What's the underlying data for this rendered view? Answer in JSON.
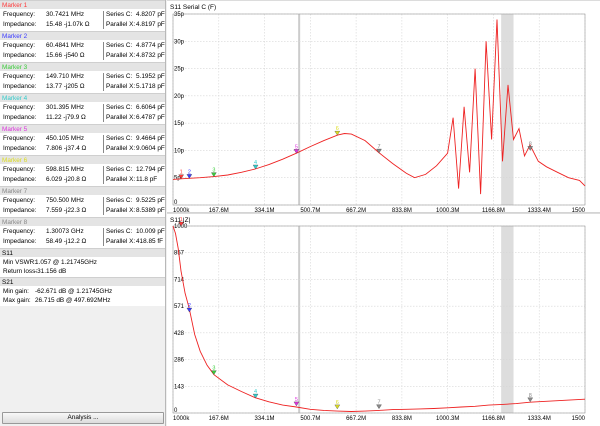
{
  "markers": [
    {
      "title": "Marker 1",
      "color": "#ff3a3a",
      "freq_label": "Frequency:",
      "freq": "30.7421 MHz",
      "imp_label": "Impedance:",
      "imp": "15.48 -j1.07k Ω",
      "r1_label": "Series C:",
      "r1": "4.8207 pF",
      "r2_label": "Parallel X:",
      "r2": "4.8197 pF"
    },
    {
      "title": "Marker 2",
      "color": "#3a3aff",
      "freq_label": "Frequency:",
      "freq": "60.4841 MHz",
      "imp_label": "Impedance:",
      "imp": "15.66 -j540 Ω",
      "r1_label": "Series C:",
      "r1": "4.8774 pF",
      "r2_label": "Parallel X:",
      "r2": "4.8732 pF"
    },
    {
      "title": "Marker 3",
      "color": "#3acc3a",
      "freq_label": "Frequency:",
      "freq": "149.710 MHz",
      "imp_label": "Impedance:",
      "imp": "13.77 -j205 Ω",
      "r1_label": "Series C:",
      "r1": "5.1952 pF",
      "r2_label": "Parallel X:",
      "r2": "5.1718 pF"
    },
    {
      "title": "Marker 4",
      "color": "#33cccc",
      "freq_label": "Frequency:",
      "freq": "301.395 MHz",
      "imp_label": "Impedance:",
      "imp": "11.22 -j79.9 Ω",
      "r1_label": "Series C:",
      "r1": "6.6064 pF",
      "r2_label": "Parallel X:",
      "r2": "6.4787 pF"
    },
    {
      "title": "Marker 5",
      "color": "#dd33dd",
      "freq_label": "Frequency:",
      "freq": "450.105 MHz",
      "imp_label": "Impedance:",
      "imp": "7.806 -j37.4 Ω",
      "r1_label": "Series C:",
      "r1": "9.4664 pF",
      "r2_label": "Parallel X:",
      "r2": "9.0604 pF"
    },
    {
      "title": "Marker 6",
      "color": "#dddd22",
      "freq_label": "Frequency:",
      "freq": "598.815 MHz",
      "imp_label": "Impedance:",
      "imp": "6.029 -j20.8 Ω",
      "r1_label": "Series C:",
      "r1": "12.794 pF",
      "r2_label": "Parallel X:",
      "r2": "11.8 pF"
    },
    {
      "title": "Marker 7",
      "color": "#888888",
      "freq_label": "Frequency:",
      "freq": "750.500 MHz",
      "imp_label": "Impedance:",
      "imp": "7.559 -j22.3 Ω",
      "r1_label": "Series C:",
      "r1": "9.5225 pF",
      "r2_label": "Parallel X:",
      "r2": "8.5389 pF"
    },
    {
      "title": "Marker 8",
      "color": "#888888",
      "freq_label": "Frequency:",
      "freq": "1.30073 GHz",
      "imp_label": "Impedance:",
      "imp": "58.49 -j12.2 Ω",
      "r1_label": "Series C:",
      "r1": "10.009 pF",
      "r2_label": "Parallel X:",
      "r2": "418.85 fF"
    }
  ],
  "s11_section": {
    "title": "S11",
    "row1_label": "Min VSWR:",
    "row1_value": "1.057 @ 1.21745GHz",
    "row2_label": "Return loss:",
    "row2_value": "-31.156 dB"
  },
  "s21_section": {
    "title": "S21",
    "row1_label": "Min gain:",
    "row1_value": "-62.671 dB @ 1.21745GHz",
    "row2_label": "Max gain:",
    "row2_value": "26.715 dB @ 497.692MHz"
  },
  "analysis_button": "Analysis ...",
  "chart_data": [
    {
      "type": "line",
      "title": "S11 Serial C (F)",
      "x_ticks": [
        "1000k",
        "167.6M",
        "334.1M",
        "500.7M",
        "667.2M",
        "833.8M",
        "1000.3M",
        "1166.8M",
        "1333.4M",
        "1500"
      ],
      "y_ticks": [
        "0",
        "5p",
        "10p",
        "15p",
        "20p",
        "25p",
        "30p",
        "35p"
      ],
      "xlim": [
        1,
        1500
      ],
      "ylim": [
        0,
        35
      ],
      "grid": true,
      "series": [
        {
          "color": "#ee2222",
          "x": [
            1,
            30,
            60,
            100,
            150,
            200,
            250,
            300,
            350,
            400,
            450,
            500,
            550,
            600,
            625,
            650,
            700,
            750,
            800,
            850,
            880,
            920,
            960,
            1000,
            1020,
            1040,
            1060,
            1080,
            1100,
            1120,
            1140,
            1160,
            1180,
            1200,
            1220,
            1240,
            1260,
            1280,
            1300,
            1330,
            1360,
            1400,
            1440,
            1480,
            1500
          ],
          "y": [
            4.7,
            4.8,
            4.9,
            5.0,
            5.2,
            5.5,
            6.0,
            6.6,
            7.4,
            8.4,
            9.5,
            10.7,
            11.8,
            12.8,
            13.1,
            13.0,
            11.8,
            9.6,
            7.6,
            5.8,
            5.0,
            5.6,
            7.2,
            9.5,
            16,
            3,
            18,
            6,
            25,
            2,
            30,
            12,
            34,
            8,
            22,
            12,
            14,
            9,
            11,
            8,
            7,
            6,
            5,
            4.5,
            3.5
          ]
        }
      ],
      "markers": [
        {
          "label": "1",
          "x": 30.7421,
          "y": 4.82,
          "color": "#ff3a3a"
        },
        {
          "label": "2",
          "x": 60.4841,
          "y": 4.88,
          "color": "#3a3aff"
        },
        {
          "label": "3",
          "x": 149.71,
          "y": 5.2,
          "color": "#3acc3a"
        },
        {
          "label": "4",
          "x": 301.395,
          "y": 6.6,
          "color": "#33cccc"
        },
        {
          "label": "5",
          "x": 450.105,
          "y": 9.47,
          "color": "#dd33dd"
        },
        {
          "label": "6",
          "x": 598.815,
          "y": 12.8,
          "color": "#dddd22"
        },
        {
          "label": "7",
          "x": 750.5,
          "y": 9.52,
          "color": "#888888"
        },
        {
          "label": "8",
          "x": 1300.73,
          "y": 10.0,
          "color": "#888888"
        }
      ],
      "shaded_x_range": [
        1195,
        1240
      ],
      "vertical_line_x": 460
    },
    {
      "type": "line",
      "title": "S11 |Z|",
      "x_ticks": [
        "1000k",
        "167.6M",
        "334.1M",
        "500.7M",
        "667.2M",
        "833.8M",
        "1000.3M",
        "1166.8M",
        "1333.4M",
        "1500"
      ],
      "y_ticks": [
        "0",
        "143",
        "286",
        "428",
        "571",
        "714",
        "857",
        "1000"
      ],
      "xlim": [
        1,
        1500
      ],
      "ylim": [
        0,
        1000
      ],
      "grid": true,
      "series": [
        {
          "color": "#ee2222",
          "x": [
            1,
            10,
            20,
            30,
            45,
            60,
            80,
            100,
            125,
            150,
            200,
            250,
            300,
            350,
            400,
            450,
            500,
            550,
            600,
            650,
            700,
            750,
            800,
            850,
            900,
            950,
            1000,
            1050,
            1100,
            1150,
            1200,
            1250,
            1300,
            1350,
            1400,
            1450,
            1500
          ],
          "y": [
            1000,
            960,
            880,
            760,
            640,
            560,
            420,
            330,
            255,
            205,
            150,
            115,
            82,
            60,
            42,
            32,
            20,
            14,
            10,
            8,
            10,
            14,
            18,
            20,
            22,
            24,
            28,
            32,
            36,
            42,
            46,
            50,
            58,
            62,
            66,
            70,
            74
          ]
        }
      ],
      "markers": [
        {
          "label": "1",
          "x": 30.7421,
          "y": 1070,
          "color": "#ff3a3a"
        },
        {
          "label": "2",
          "x": 60.4841,
          "y": 540,
          "color": "#3a3aff"
        },
        {
          "label": "3",
          "x": 149.71,
          "y": 205,
          "color": "#3acc3a"
        },
        {
          "label": "4",
          "x": 301.395,
          "y": 80,
          "color": "#33cccc"
        },
        {
          "label": "5",
          "x": 450.105,
          "y": 38,
          "color": "#dd33dd"
        },
        {
          "label": "6",
          "x": 598.815,
          "y": 22,
          "color": "#dddd22"
        },
        {
          "label": "7",
          "x": 750.5,
          "y": 23,
          "color": "#888888"
        },
        {
          "label": "8",
          "x": 1300.73,
          "y": 60,
          "color": "#888888"
        }
      ],
      "shaded_x_range": [
        1195,
        1240
      ],
      "vertical_line_x": 460
    }
  ]
}
